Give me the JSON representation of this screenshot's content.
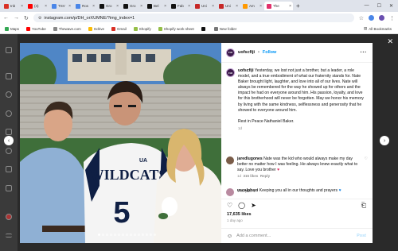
{
  "browser": {
    "tabs": [
      {
        "label": "Inb",
        "color": "#d93025"
      },
      {
        "label": "(4)",
        "color": "#ff0000"
      },
      {
        "label": "TSV",
        "color": "#4a86e8"
      },
      {
        "label": "Ros",
        "color": "#4a86e8"
      },
      {
        "label": "Gro",
        "color": "#111111"
      },
      {
        "label": "Gro",
        "color": "#111111"
      },
      {
        "label": "Bel",
        "color": "#111111"
      },
      {
        "label": "Fab",
        "color": "#111111"
      },
      {
        "label": "Uni",
        "color": "#c62828"
      },
      {
        "label": "Uni",
        "color": "#c62828"
      },
      {
        "label": "Am",
        "color": "#ff9900"
      },
      {
        "label": "The",
        "color": "#e1306c",
        "active": true
      }
    ],
    "url": "instagram.com/p/DH_orXUMNE/?img_index=1",
    "bookmarks": [
      {
        "label": "Maps",
        "color": "#34a853"
      },
      {
        "label": "YouTube",
        "color": "#ff0000"
      },
      {
        "label": "Thewave.com",
        "color": "#888888"
      },
      {
        "label": "Gdrive",
        "color": "#fbbc04"
      },
      {
        "label": "Gmail",
        "color": "#d93025"
      },
      {
        "label": "Shopify",
        "color": "#95bf47"
      },
      {
        "label": "Shopify work sheet",
        "color": "#95bf47"
      },
      {
        "label": "",
        "color": "#111111"
      },
      {
        "label": "New folder",
        "color": "#777777"
      }
    ],
    "all_bookmarks": "All Bookmarks"
  },
  "post": {
    "username": "uofscfiji",
    "follow": "Follow",
    "avatar_text": "FIJI",
    "caption": {
      "body": "Yesterday, we lost not just a brother, but a leader, a role model, and a true embodiment of what our fraternity stands for. Nate Baker brought light, laughter, and love into all of our lives. Nate will always be remembered for the way he showed up for others and the impact he had on everyone around him. His passion, loyalty, and love for this brotherhood will never be forgotten. May we honor his memory by living with the same kindness, selflessness and generosity that he showed to everyone around him.",
      "closing": "Rest in Peace Nathaniel Baker.",
      "time": "1d"
    },
    "for_you": "For you ⌄",
    "comments": [
      {
        "user": "jaredlugones",
        "text": "Nate was the kid who would always make my day better no matter how I was feeling. He always knew exactly what to say. Love you brother",
        "emoji": "♥",
        "time": "1d",
        "likes": "315 likes",
        "reply": "Reply",
        "avatar_color": "#7a5c48"
      },
      {
        "user": "uscalphaxi",
        "text": "Keeping you all in our thoughts and prayers",
        "emoji": "♥",
        "avatar_color": "#b98aa0"
      }
    ],
    "likes": "17,635 likes",
    "age": "1 day ago",
    "add_comment_placeholder": "Add a comment...",
    "post_label": "Post"
  },
  "photo": {
    "jersey_text": "WILDCATS",
    "jersey_number": "5",
    "ua_logo": "UA"
  }
}
